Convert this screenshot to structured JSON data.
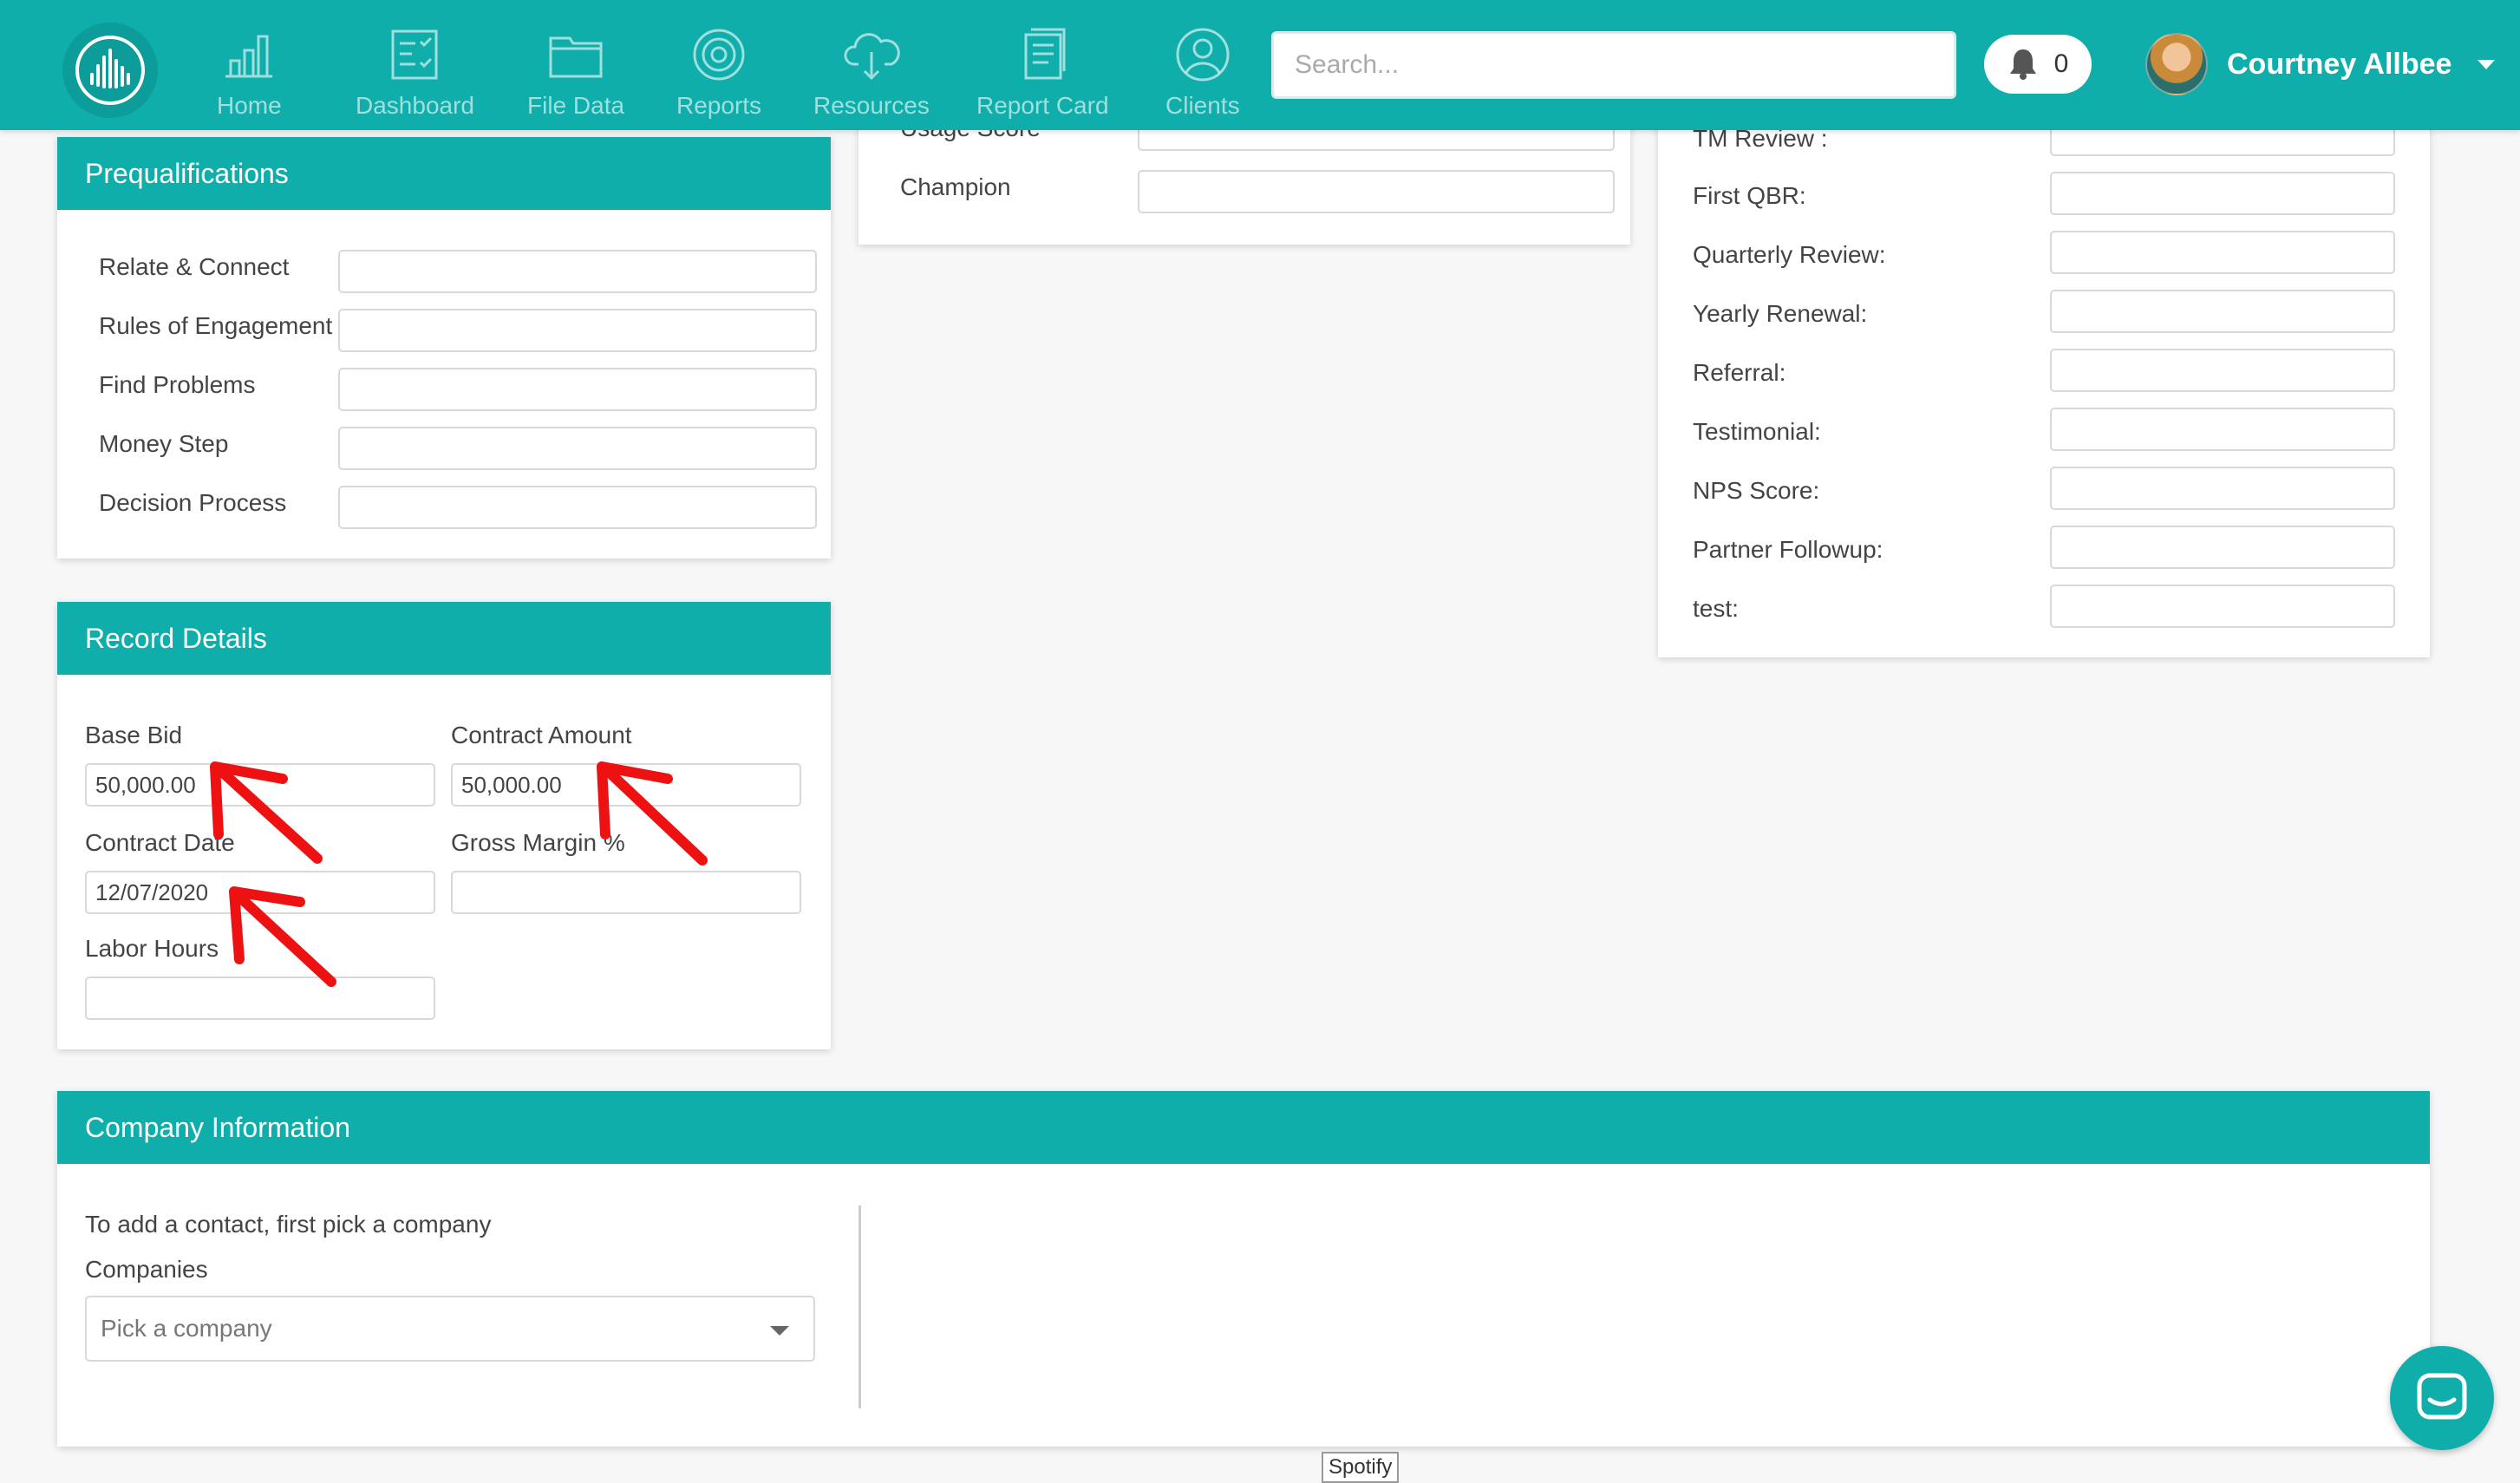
{
  "nav": {
    "items": [
      {
        "label": "Home",
        "icon": "bar-chart-icon",
        "active": false
      },
      {
        "label": "Dashboard",
        "icon": "checklist-icon",
        "active": false
      },
      {
        "label": "File Data",
        "icon": "folder-icon",
        "active": true
      },
      {
        "label": "Reports",
        "icon": "target-icon",
        "active": false
      },
      {
        "label": "Resources",
        "icon": "cloud-download-icon",
        "active": false
      },
      {
        "label": "Report Card",
        "icon": "document-icon",
        "active": false
      },
      {
        "label": "Clients",
        "icon": "user-circle-icon",
        "active": false
      }
    ],
    "search_placeholder": "Search...",
    "notification_count": "0",
    "user_name": "Courtney Allbee"
  },
  "colors": {
    "brand": "#10aeab",
    "arrow": "#ee1111"
  },
  "prequal": {
    "title": "Prequalifications",
    "fields": [
      {
        "label": "Relate & Connect",
        "value": ""
      },
      {
        "label": "Rules of Engagement",
        "value": ""
      },
      {
        "label": "Find Problems",
        "value": ""
      },
      {
        "label": "Money Step",
        "value": ""
      },
      {
        "label": "Decision Process",
        "value": ""
      }
    ]
  },
  "middle": {
    "partial_label": "Usage Score",
    "champion_label": "Champion"
  },
  "review": {
    "partial_label": "TM Review :",
    "fields": [
      {
        "label": "First QBR:",
        "value": ""
      },
      {
        "label": "Quarterly Review:",
        "value": ""
      },
      {
        "label": "Yearly Renewal:",
        "value": ""
      },
      {
        "label": "Referral:",
        "value": ""
      },
      {
        "label": "Testimonial:",
        "value": ""
      },
      {
        "label": "NPS Score:",
        "value": ""
      },
      {
        "label": "Partner Followup:",
        "value": ""
      },
      {
        "label": "test:",
        "value": ""
      }
    ]
  },
  "record": {
    "title": "Record Details",
    "base_bid_label": "Base Bid",
    "base_bid_value": "50,000.00",
    "contract_amount_label": "Contract Amount",
    "contract_amount_value": "50,000.00",
    "contract_date_label": "Contract Date",
    "contract_date_value": "12/07/2020",
    "gross_margin_label": "Gross Margin %",
    "gross_margin_value": "",
    "labor_hours_label": "Labor Hours",
    "labor_hours_value": ""
  },
  "company": {
    "title": "Company Information",
    "hint": "To add a contact, first pick a company",
    "companies_label": "Companies",
    "select_placeholder": "Pick a company"
  },
  "footer_tag": "Spotify"
}
